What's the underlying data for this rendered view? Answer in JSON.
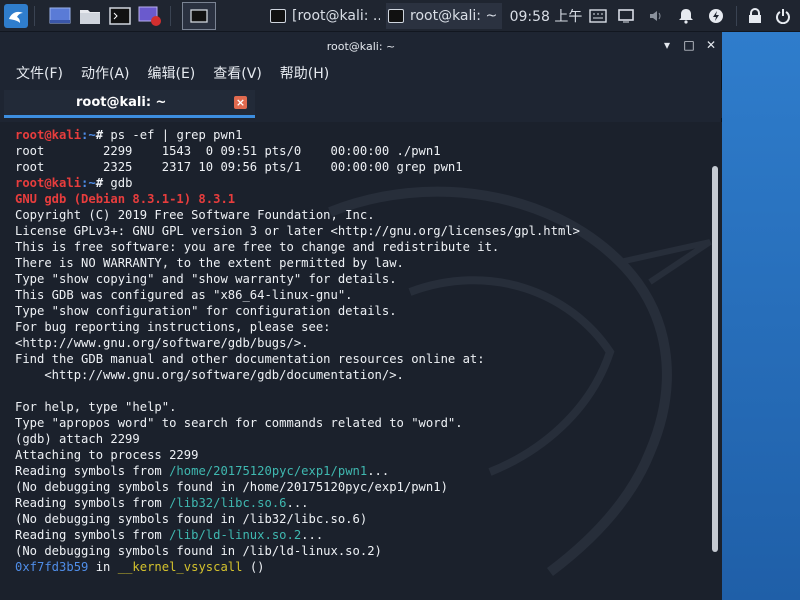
{
  "panel": {
    "tasks": [
      {
        "label": "[root@kali: ..."
      },
      {
        "label": "root@kali: ~"
      }
    ],
    "clock": "09:58 上午"
  },
  "window": {
    "title": "root@kali: ~",
    "menu": [
      "文件(F)",
      "动作(A)",
      "编辑(E)",
      "查看(V)",
      "帮助(H)"
    ],
    "tab_label": "root@kali: ~"
  },
  "terminal": {
    "prompt_user": "root@kali",
    "prompt_path": ":~",
    "prompt_hash": "# ",
    "cmd1": "ps -ef | grep pwn1",
    "ps_row1": "root        2299    1543  0 09:51 pts/0    00:00:00 ./pwn1",
    "ps_row2": "root        2325    2317 10 09:56 pts/1    00:00:00 grep pwn1",
    "cmd2": "gdb",
    "gdb_version": "GNU gdb (Debian 8.3.1-1) 8.3.1",
    "banner": [
      "Copyright (C) 2019 Free Software Foundation, Inc.",
      "License GPLv3+: GNU GPL version 3 or later <http://gnu.org/licenses/gpl.html>",
      "This is free software: you are free to change and redistribute it.",
      "There is NO WARRANTY, to the extent permitted by law.",
      "Type \"show copying\" and \"show warranty\" for details.",
      "This GDB was configured as \"x86_64-linux-gnu\".",
      "Type \"show configuration\" for configuration details.",
      "For bug reporting instructions, please see:",
      "<http://www.gnu.org/software/gdb/bugs/>.",
      "Find the GDB manual and other documentation resources online at:",
      "    <http://www.gnu.org/software/gdb/documentation/>.",
      "",
      "For help, type \"help\".",
      "Type \"apropos word\" to search for commands related to \"word\".",
      "(gdb) attach 2299",
      "Attaching to process 2299"
    ],
    "reading_prefix": "Reading symbols from ",
    "ellipsis": "...",
    "sym1_path": "/home/20175120pyc/exp1/pwn1",
    "sym1_note": "(No debugging symbols found in /home/20175120pyc/exp1/pwn1)",
    "sym2_path": "/lib32/libc.so.6",
    "sym2_note": "(No debugging symbols found in /lib32/libc.so.6)",
    "sym3_path": "/lib/ld-linux.so.2",
    "sym3_note": "(No debugging symbols found in /lib/ld-linux.so.2)",
    "frame_addr": "0xf7fd3b59",
    "frame_in": " in ",
    "frame_func": "__kernel_vsyscall",
    "frame_args": " ()"
  },
  "colors": {
    "prompt_red": "#e83d3d",
    "accent_blue": "#3d8ee0",
    "path_teal": "#3fb8b0",
    "func_yellow": "#d4c22d"
  }
}
